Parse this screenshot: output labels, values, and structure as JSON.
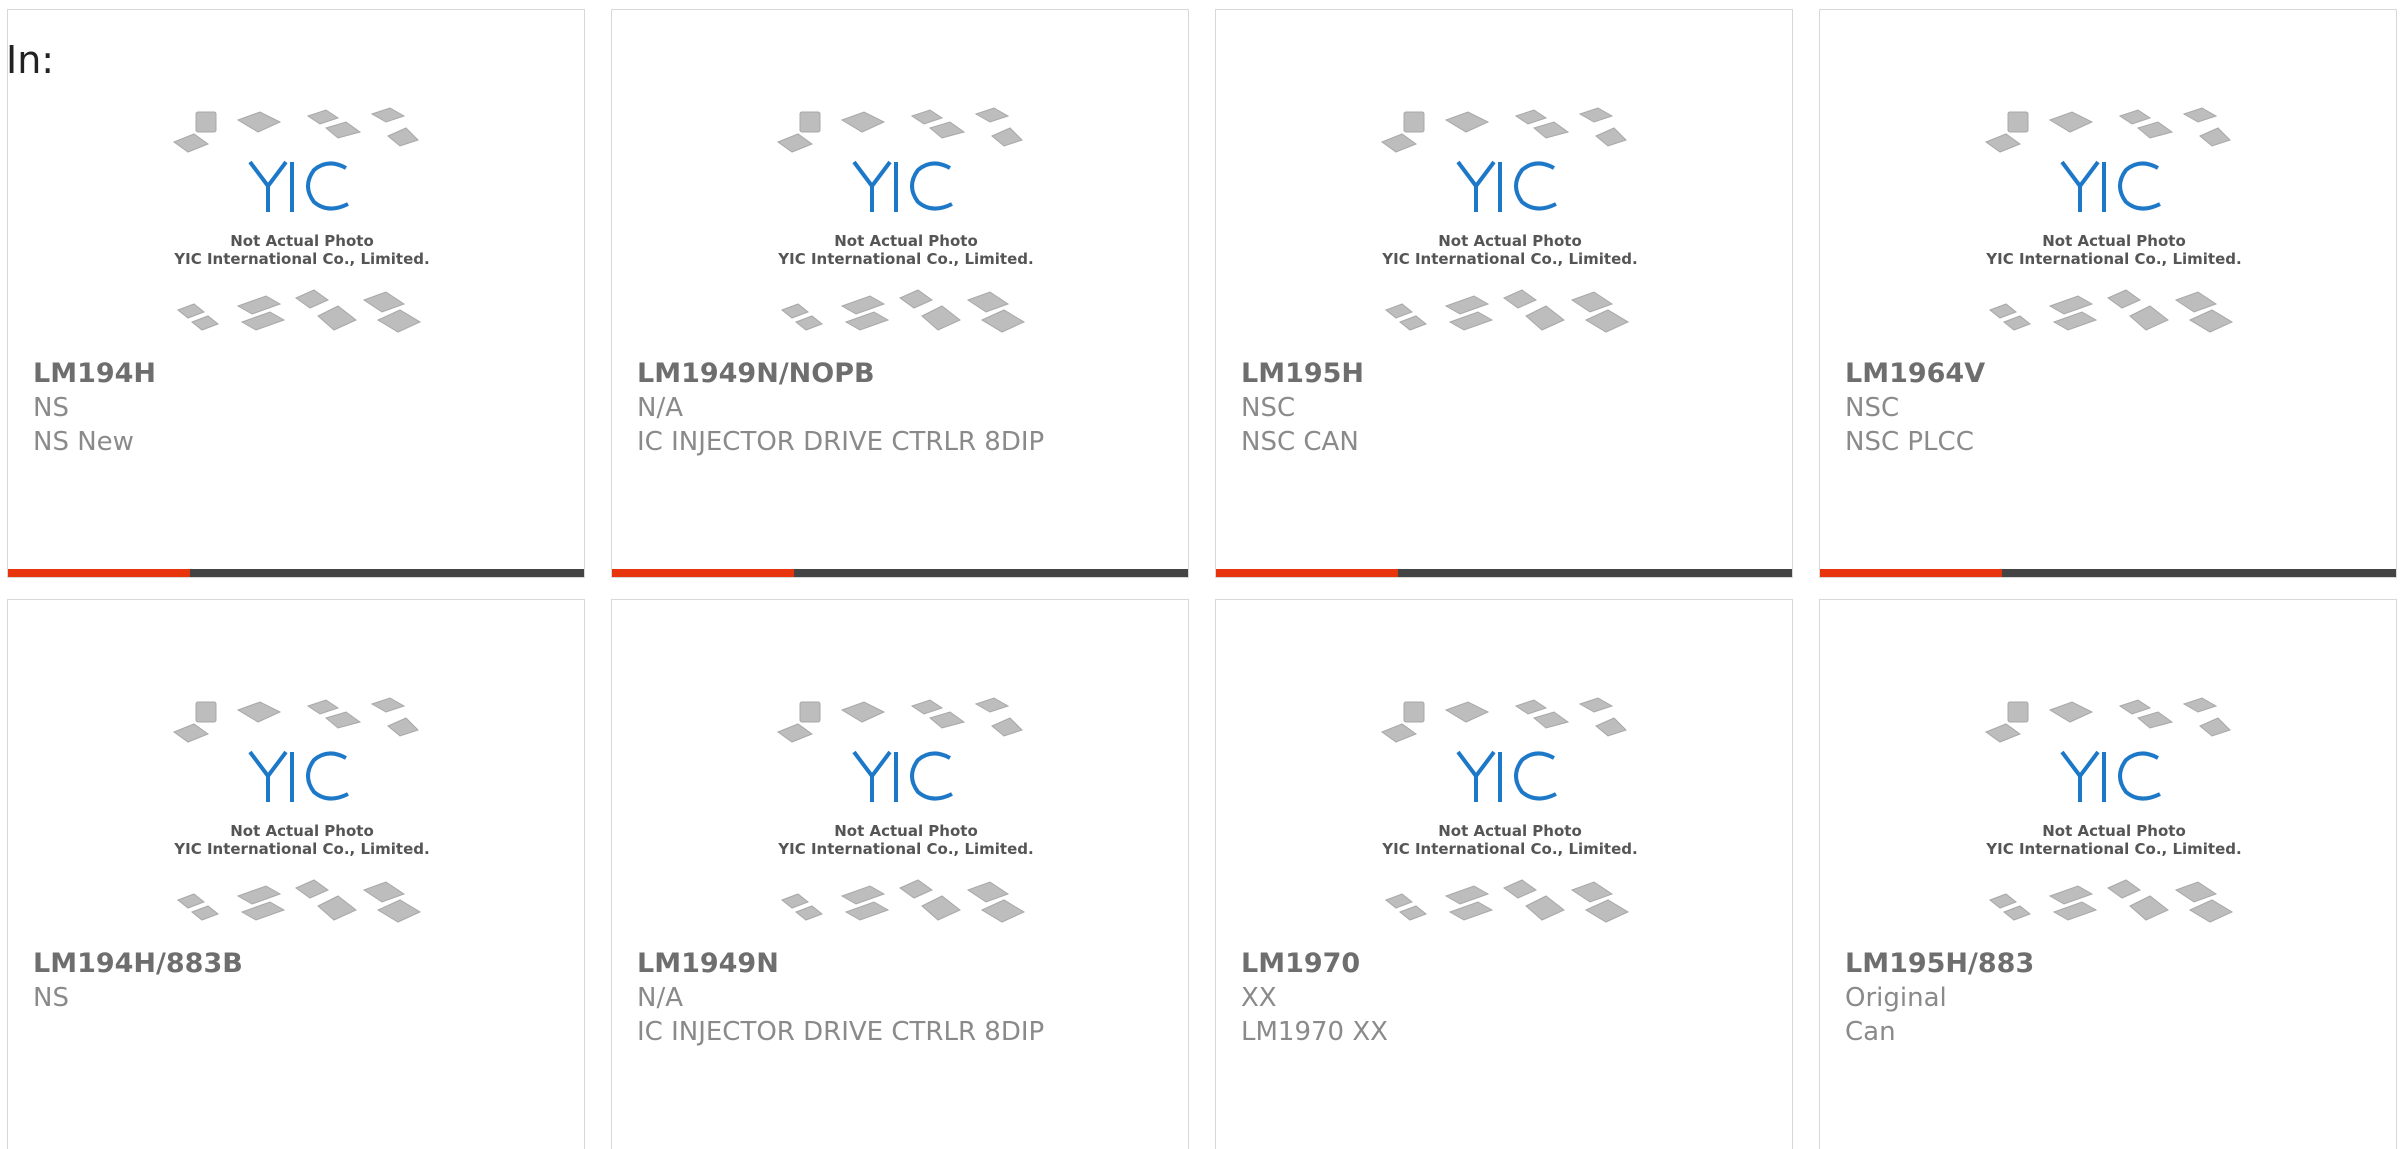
{
  "header": {
    "label": "In:"
  },
  "placeholder": {
    "logo": "YIC",
    "line1": "Not Actual Photo",
    "line2": "YIC International Co., Limited."
  },
  "colors": {
    "accent": "#e8340d",
    "bar": "#444444",
    "logo": "#1e78c8",
    "chip": "#bdbdbd"
  },
  "products": [
    {
      "part": "LM194H",
      "brand": "NS",
      "desc": "NS New"
    },
    {
      "part": "LM1949N/NOPB",
      "brand": "N/A",
      "desc": "IC INJECTOR DRIVE CTRLR 8DIP"
    },
    {
      "part": "LM195H",
      "brand": "NSC",
      "desc": "NSC CAN"
    },
    {
      "part": "LM1964V",
      "brand": "NSC",
      "desc": "NSC PLCC"
    },
    {
      "part": "LM194H/883B",
      "brand": "NS",
      "desc": ""
    },
    {
      "part": "LM1949N",
      "brand": "N/A",
      "desc": "IC INJECTOR DRIVE CTRLR 8DIP"
    },
    {
      "part": "LM1970",
      "brand": "XX",
      "desc": "LM1970 XX"
    },
    {
      "part": "LM195H/883",
      "brand": "Original",
      "desc": "Can"
    }
  ]
}
